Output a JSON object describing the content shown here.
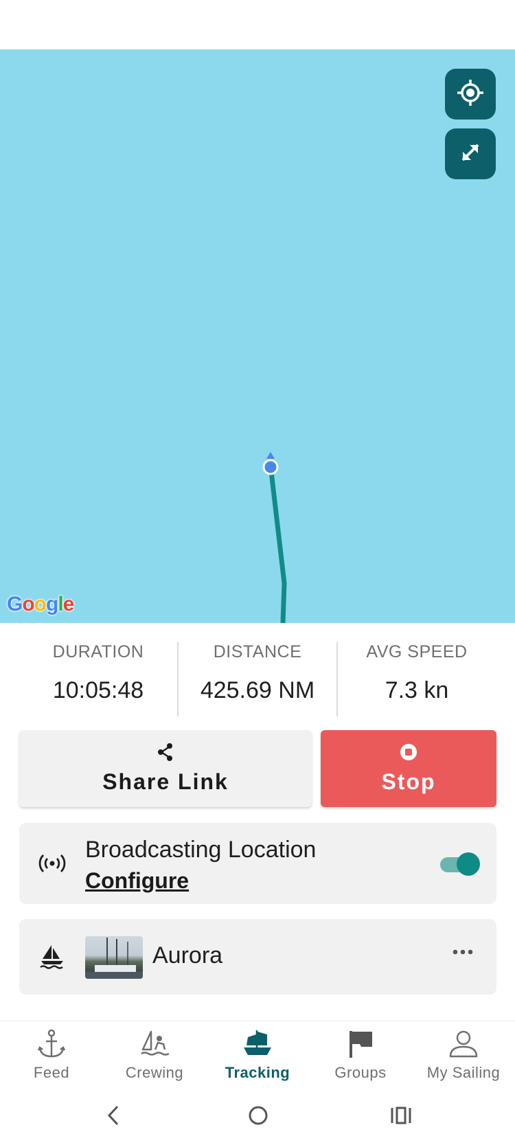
{
  "map": {
    "attribution": "Google",
    "colors": {
      "water": "#8cd9ed",
      "track": "#138a8a",
      "position_dot": "#4a87e6",
      "button_bg": "#0d5f6a"
    },
    "buttons": {
      "locate": "crosshair-icon",
      "expand": "expand-arrows-icon"
    }
  },
  "stats": {
    "duration": {
      "label": "DURATION",
      "value": "10:05:48"
    },
    "distance": {
      "label": "DISTANCE",
      "value": "425.69 NM"
    },
    "avg_speed": {
      "label": "AVG SPEED",
      "value": "7.3 kn"
    }
  },
  "actions": {
    "share": {
      "label": "Share Link",
      "icon": "share-icon"
    },
    "stop": {
      "label": "Stop",
      "icon": "stop-icon",
      "color": "#ea5a5a"
    }
  },
  "broadcast": {
    "title": "Broadcasting Location",
    "link": "Configure",
    "enabled": true,
    "icon": "broadcast-icon"
  },
  "boat": {
    "name": "Aurora",
    "icon": "sailboat-icon",
    "menu_icon": "more-horizontal-icon"
  },
  "nav": {
    "items": [
      {
        "label": "Feed",
        "icon": "anchor-icon"
      },
      {
        "label": "Crewing",
        "icon": "crewing-icon"
      },
      {
        "label": "Tracking",
        "icon": "ship-icon",
        "active": true
      },
      {
        "label": "Groups",
        "icon": "flag-icon"
      },
      {
        "label": "My Sailing",
        "icon": "person-icon"
      }
    ],
    "active_color": "#0d5f6a"
  },
  "system_nav": {
    "back": "back-icon",
    "home": "home-icon",
    "recents": "recents-icon"
  }
}
